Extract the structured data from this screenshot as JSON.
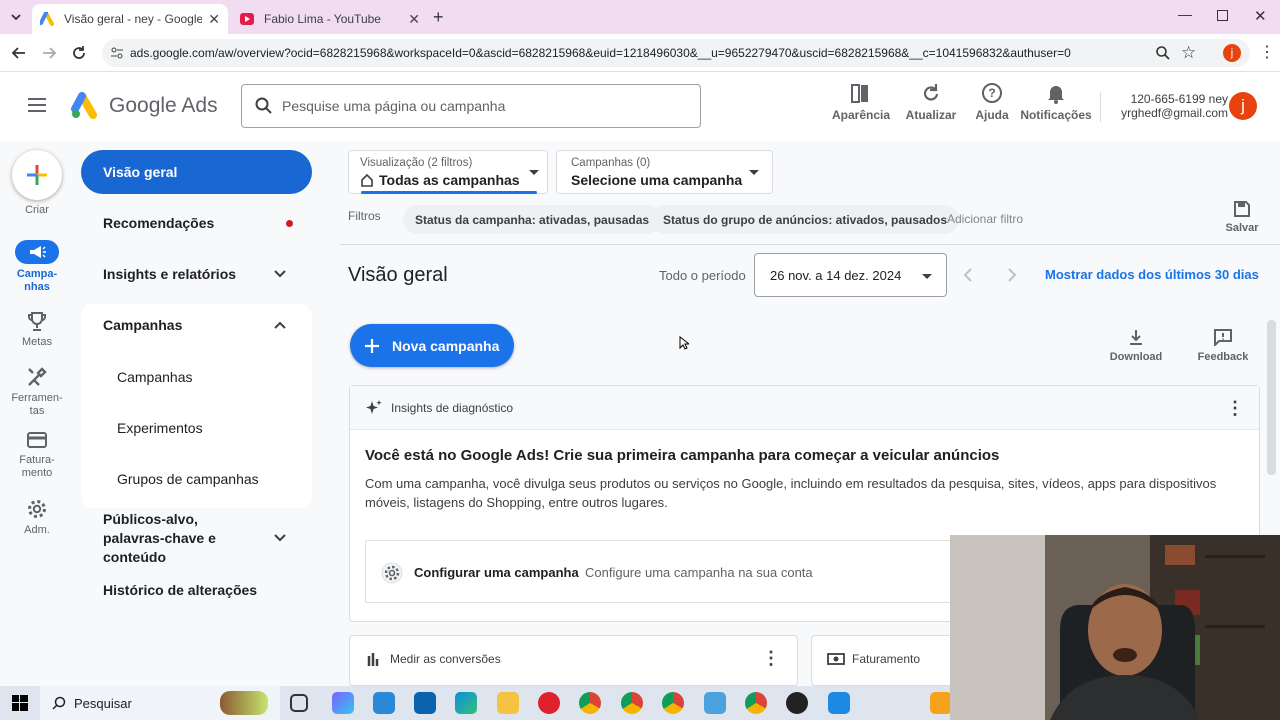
{
  "browser": {
    "tabs": [
      {
        "title": "Visão geral - ney - Google Ads",
        "active": true
      },
      {
        "title": "Fabio Lima - YouTube",
        "active": false
      }
    ],
    "url": "ads.google.com/aw/overview?ocid=6828215968&workspaceId=0&ascid=6828215968&euid=1218496030&__u=9652279470&uscid=6828215968&__c=1041596832&authuser=0",
    "profile_initial": "j"
  },
  "header": {
    "brand": "Google Ads",
    "search_placeholder": "Pesquise uma página ou campanha",
    "buttons": {
      "appearance": "Aparência",
      "refresh": "Atualizar",
      "help": "Ajuda",
      "notifications": "Notificações"
    },
    "account_id": "120-665-6199 ney",
    "account_email": "yrghedf@gmail.com",
    "avatar_initial": "j"
  },
  "rail": {
    "create": "Criar",
    "campaigns": "Campa-\nnhas",
    "goals": "Metas",
    "tools": "Ferramen-\ntas",
    "billing": "Fatura-\nmento",
    "admin": "Adm."
  },
  "nav": {
    "overview": "Visão geral",
    "recommendations": "Recomendações",
    "insights": "Insights e relatórios",
    "campaigns": "Campanhas",
    "sub_campaigns": "Campanhas",
    "experiments": "Experimentos",
    "campaign_groups": "Grupos de campanhas",
    "audiences": "Públicos-alvo, palavras-chave e conteúdo",
    "change_history": "Histórico de alterações"
  },
  "filters": {
    "view_label": "Visualização (2 filtros)",
    "view_value": "Todas as campanhas",
    "campaigns_label": "Campanhas (0)",
    "campaigns_value": "Selecione uma campanha",
    "filters_label": "Filtros",
    "chip1": "Status da campanha: ativadas, pausadas",
    "chip2": "Status do grupo de anúncios: ativados, pausados",
    "add_filter": "Adicionar filtro",
    "save": "Salvar"
  },
  "main": {
    "title": "Visão geral",
    "period_label": "Todo o período",
    "date_range": "26 nov. a 14 dez. 2024",
    "last30": "Mostrar dados dos últimos 30 dias",
    "new_campaign": "Nova campanha",
    "download": "Download",
    "feedback": "Feedback"
  },
  "insights_card": {
    "header": "Insights de diagnóstico",
    "title": "Você está no Google Ads! Crie sua primeira campanha para começar a veicular anúncios",
    "body": "Com uma campanha, você divulga seus produtos ou serviços no Google, incluindo em resultados da pesquisa, sites, vídeos, apps para dispositivos móveis, listagens do Shopping, entre outros lugares.",
    "setup_title": "Configurar uma campanha",
    "setup_desc": "Configure uma campanha na sua conta"
  },
  "bottom_cards": {
    "conversions": "Medir as conversões",
    "billing": "Faturamento"
  },
  "taskbar": {
    "search": "Pesquisar"
  },
  "colors": {
    "primary": "#1a73e8",
    "nav_active": "#1967d2",
    "avatar": "#e8430f",
    "tabbar": "#f1dcf1"
  }
}
